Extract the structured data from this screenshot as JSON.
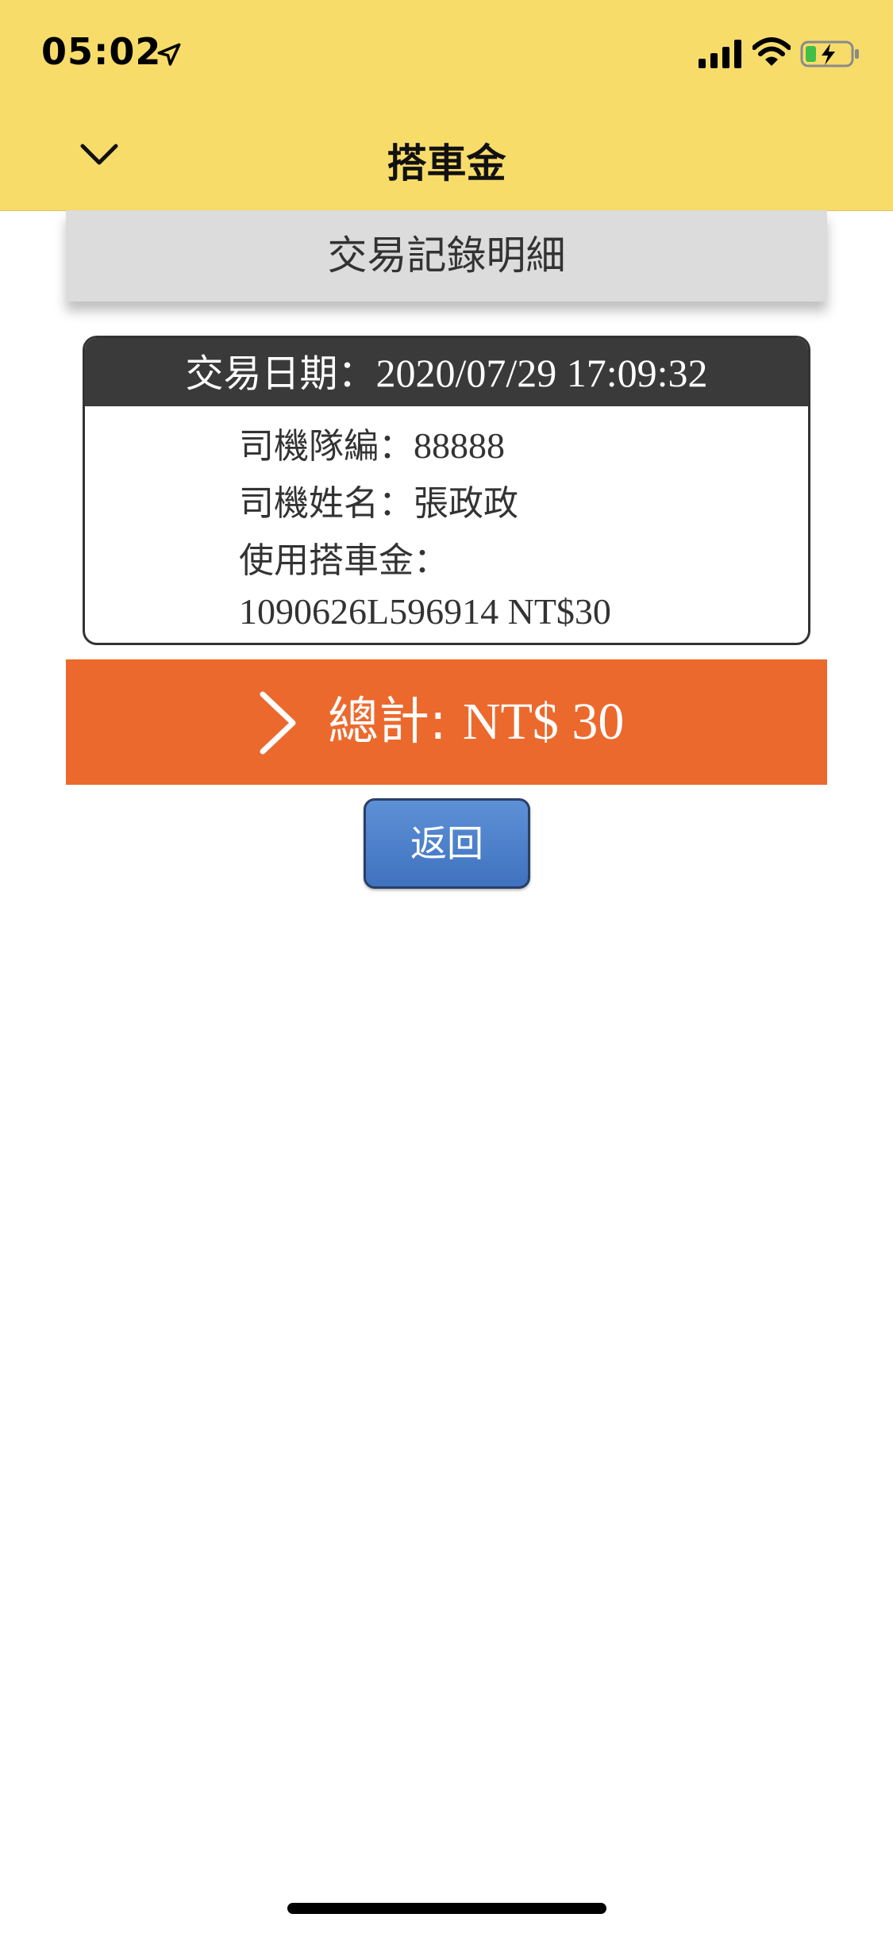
{
  "status_bar": {
    "time": "05:02"
  },
  "nav": {
    "title": "搭車金"
  },
  "section": {
    "title": "交易記錄明細"
  },
  "detail": {
    "date_label": "交易日期：",
    "date_value": "2020/07/29 17:09:32",
    "driver_team_label": "司機隊編：",
    "driver_team_value": "88888",
    "driver_name_label": "司機姓名：",
    "driver_name_value": "張政政",
    "usage_label": "使用搭車金：",
    "usage_value": "1090626L596914 NT$30"
  },
  "total": {
    "label": "總計:",
    "value": "NT$ 30"
  },
  "actions": {
    "back_label": "返回"
  },
  "colors": {
    "topbar": "#F7DC6A",
    "section_header": "#DCDCDC",
    "card_header": "#3A3A3A",
    "total_bar": "#EC692D",
    "back_button": "#4A7CC7"
  },
  "icons": {
    "location": "location-arrow-icon",
    "signal": "cellular-signal-icon",
    "wifi": "wifi-icon",
    "battery": "battery-charging-icon",
    "nav_back": "chevron-down-icon",
    "total_marker": "chevron-right-icon"
  }
}
